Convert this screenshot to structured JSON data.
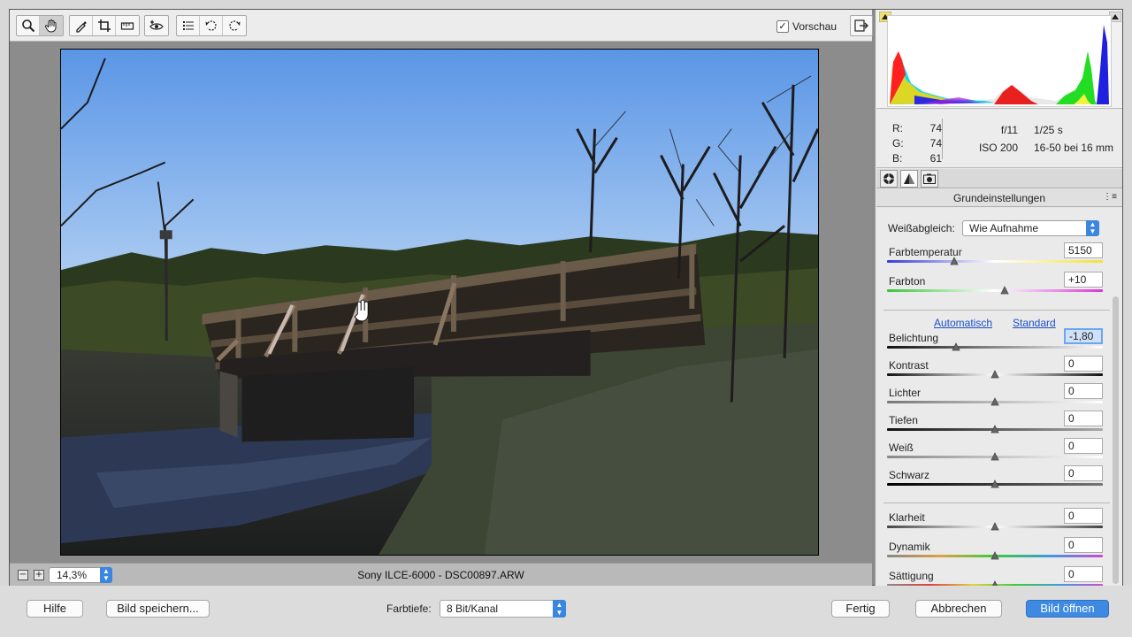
{
  "toolbar": {
    "tools": [
      {
        "icon": "zoom-tool-icon"
      },
      {
        "icon": "hand-tool-icon"
      },
      {
        "icon": "white-balance-tool-icon"
      },
      {
        "icon": "crop-tool-icon"
      },
      {
        "icon": "straighten-tool-icon"
      },
      {
        "icon": "red-eye-tool-icon"
      },
      {
        "icon": "preferences-icon"
      },
      {
        "icon": "rotate-left-icon"
      },
      {
        "icon": "rotate-right-icon"
      }
    ],
    "preview_label": "Vorschau",
    "preview_checked": true
  },
  "status": {
    "zoom": "14,3%",
    "filename": "Sony ILCE-6000 - DSC00897.ARW"
  },
  "readout": {
    "r_label": "R:",
    "r_value": "74",
    "g_label": "G:",
    "g_value": "74",
    "b_label": "B:",
    "b_value": "61",
    "aperture": "f/11",
    "shutter": "1/25 s",
    "iso": "ISO 200",
    "lens": "16-50 bei 16 mm"
  },
  "panel": {
    "section_title": "Grundeinstellungen",
    "white_balance_label": "Weißabgleich:",
    "white_balance_value": "Wie Aufnahme",
    "auto_link": "Automatisch",
    "standard_link": "Standard",
    "sliders": [
      {
        "label": "Farbtemperatur",
        "value": "5150",
        "position": 0.31
      },
      {
        "label": "Farbton",
        "value": "+10",
        "position": 0.545
      },
      {
        "label": "Belichtung",
        "value": "-1,80",
        "position": 0.32
      },
      {
        "label": "Kontrast",
        "value": "0",
        "position": 0.5
      },
      {
        "label": "Lichter",
        "value": "0",
        "position": 0.5
      },
      {
        "label": "Tiefen",
        "value": "0",
        "position": 0.5
      },
      {
        "label": "Weiß",
        "value": "0",
        "position": 0.5
      },
      {
        "label": "Schwarz",
        "value": "0",
        "position": 0.5
      },
      {
        "label": "Klarheit",
        "value": "0",
        "position": 0.5
      },
      {
        "label": "Dynamik",
        "value": "0",
        "position": 0.5
      },
      {
        "label": "Sättigung",
        "value": "0",
        "position": 0.5
      }
    ]
  },
  "bottom": {
    "help": "Hilfe",
    "save": "Bild speichern...",
    "depth_label": "Farbtiefe:",
    "depth_value": "8 Bit/Kanal",
    "done": "Fertig",
    "cancel": "Abbrechen",
    "open": "Bild öffnen"
  },
  "colors": {
    "accent": "#3e8ae3",
    "link": "#1a4fc9"
  }
}
